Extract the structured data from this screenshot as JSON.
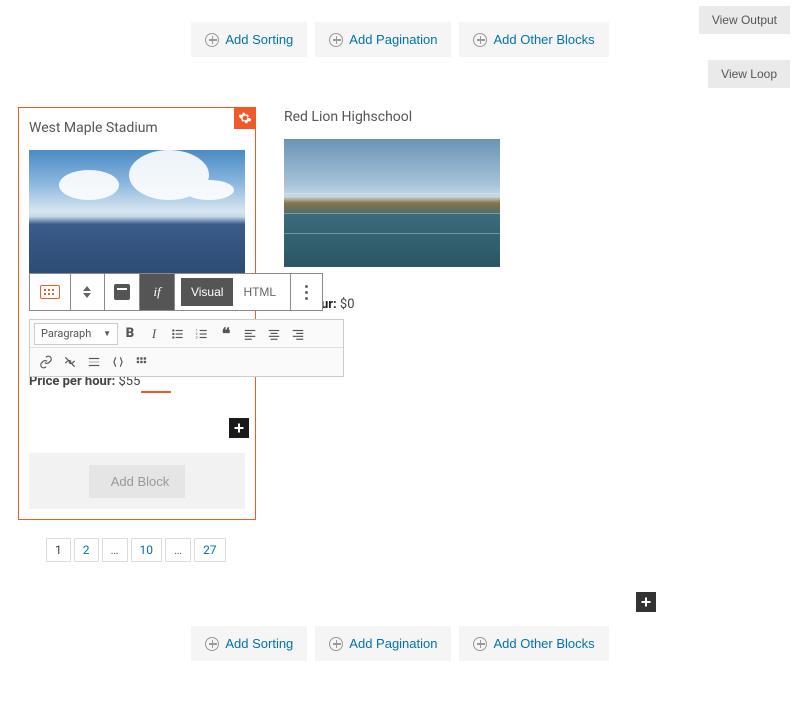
{
  "top_actions": {
    "sorting": "Add Sorting",
    "pagination": "Add Pagination",
    "other": "Add Other Blocks",
    "view_output": "View Output",
    "view_loop": "View Loop"
  },
  "cards": [
    {
      "title": "West Maple Stadium",
      "price_label": "Price per hour:",
      "price_value": "$55"
    },
    {
      "title": "Red Lion Highschool",
      "price_label": "per hour:",
      "price_value": "$0"
    }
  ],
  "block_toolbar": {
    "visual": "Visual",
    "html": "HTML",
    "if": "if"
  },
  "editor_toolbar": {
    "paragraph": "Paragraph"
  },
  "add_block": "Add Block",
  "pagination": [
    "1",
    "2",
    "…",
    "10",
    "…",
    "27"
  ]
}
